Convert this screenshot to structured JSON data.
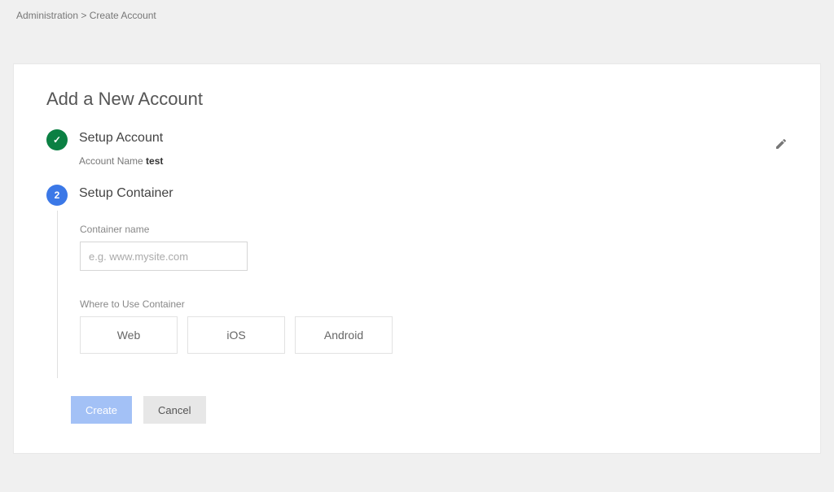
{
  "breadcrumb": {
    "text": "Administration > Create Account"
  },
  "page": {
    "title": "Add a New Account"
  },
  "step1": {
    "title": "Setup Account",
    "field_label": "Account Name",
    "field_value": "test",
    "badge_icon": "✓"
  },
  "step2": {
    "title": "Setup Container",
    "badge_number": "2",
    "container_name": {
      "label": "Container name",
      "placeholder": "e.g. www.mysite.com",
      "value": ""
    },
    "where_label": "Where to Use Container",
    "options": {
      "web": "Web",
      "ios": "iOS",
      "android": "Android"
    }
  },
  "buttons": {
    "create": "Create",
    "cancel": "Cancel"
  }
}
